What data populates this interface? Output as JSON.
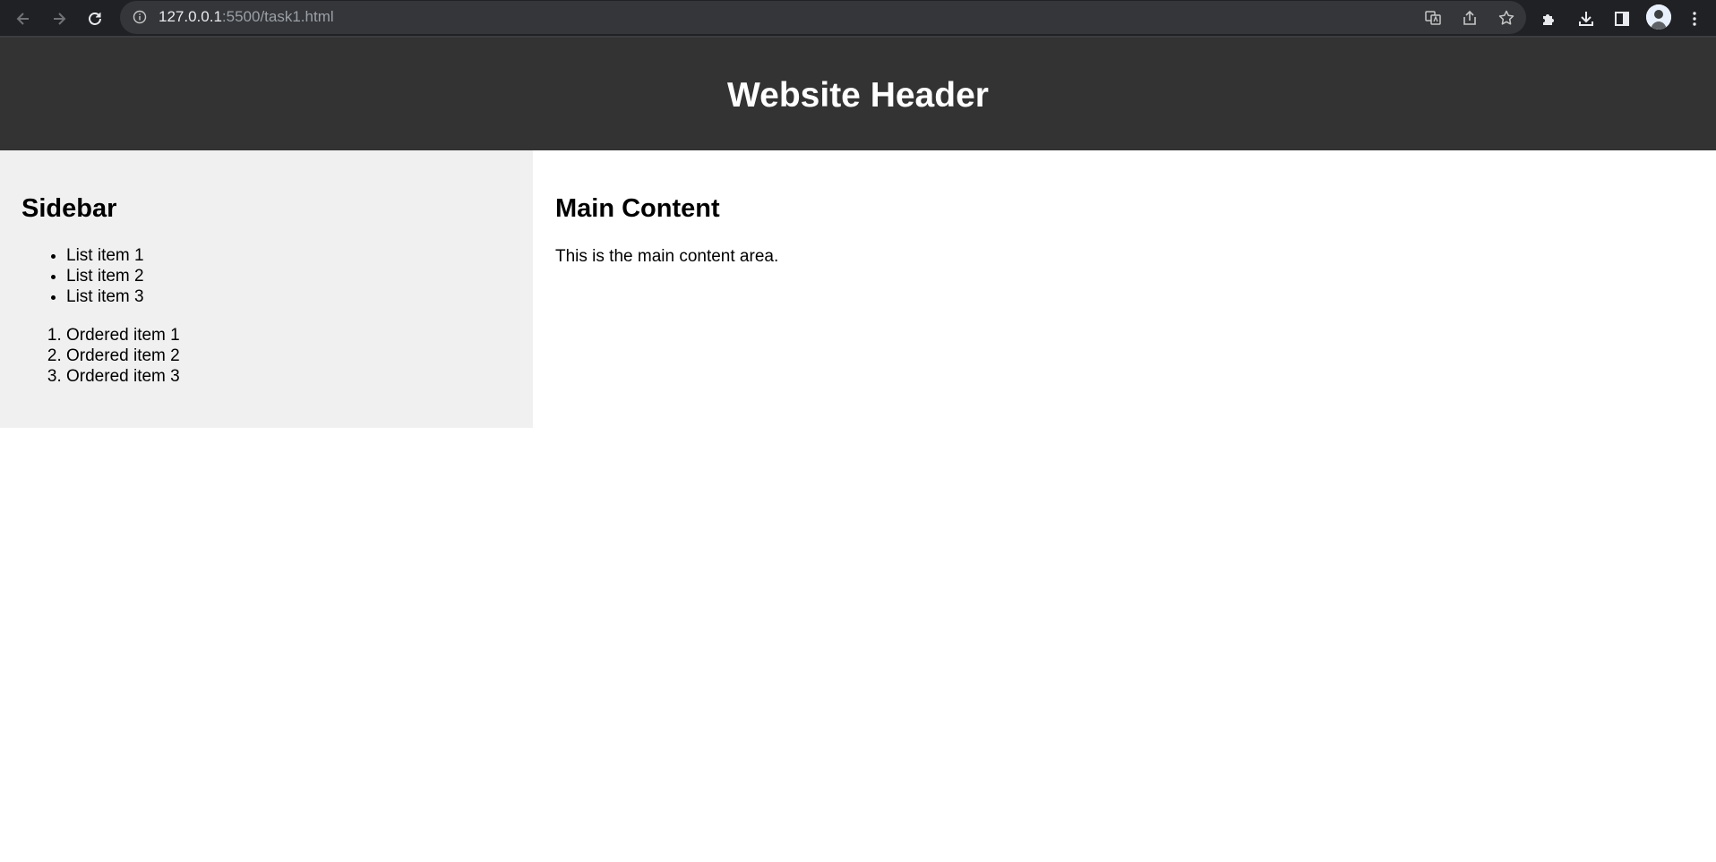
{
  "browser": {
    "url_host": "127.0.0.1",
    "url_path": ":5500/task1.html",
    "icons": {
      "back": "back-arrow-icon",
      "forward": "forward-arrow-icon",
      "reload": "reload-icon",
      "site_info": "info-icon",
      "translate": "translate-icon",
      "share": "share-icon",
      "bookmark": "star-icon",
      "extensions": "puzzle-icon",
      "downloads": "download-icon",
      "side_panel": "side-panel-icon",
      "menu": "kebab-menu-icon"
    },
    "colors": {
      "toolbar": "#202124",
      "omnibox": "#35363a"
    }
  },
  "page": {
    "header": {
      "title": "Website Header"
    },
    "sidebar": {
      "title": "Sidebar",
      "unordered_items": [
        "List item 1",
        "List item 2",
        "List item 3"
      ],
      "ordered_items": [
        "Ordered item 1",
        "Ordered item 2",
        "Ordered item 3"
      ]
    },
    "main": {
      "title": "Main Content",
      "text": "This is the main content area."
    },
    "colors": {
      "header_bg": "#333333",
      "sidebar_bg": "#f0f0f0",
      "main_bg": "#ffffff"
    }
  }
}
